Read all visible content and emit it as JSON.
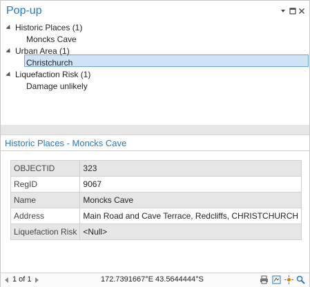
{
  "window": {
    "title": "Pop-up",
    "controls": {
      "menu_icon": "chevron-down-icon",
      "maximize_icon": "maximize-icon",
      "close_icon": "close-icon"
    }
  },
  "tree": {
    "groups": [
      {
        "label": "Historic Places (1)",
        "children": [
          "Moncks Cave"
        ]
      },
      {
        "label": "Urban Area (1)",
        "children": [
          "Christchurch"
        ]
      },
      {
        "label": "Liquefaction Risk (1)",
        "children": [
          "Damage unlikely"
        ]
      }
    ],
    "selected": "Moncks Cave"
  },
  "detail": {
    "title": "Historic Places - Moncks Cave",
    "fields": [
      {
        "name": "OBJECTID",
        "value": "323"
      },
      {
        "name": "RegID",
        "value": "9067"
      },
      {
        "name": "Name",
        "value": "Moncks Cave"
      },
      {
        "name": "Address",
        "value": "Main Road and Cave Terrace, Redcliffs, CHRISTCHURCH"
      },
      {
        "name": "Liquefaction Risk",
        "value": "<Null>"
      }
    ]
  },
  "footer": {
    "page_text": "1 of 1",
    "coordinates": "172.7391667°E 43.5644444°S",
    "icons": [
      "print-icon",
      "export-icon",
      "flash-icon",
      "zoom-to-icon"
    ]
  },
  "colors": {
    "accent": "#1f7ac9",
    "selection": "#cfe3f6",
    "selection_border": "#6ca6d9"
  }
}
